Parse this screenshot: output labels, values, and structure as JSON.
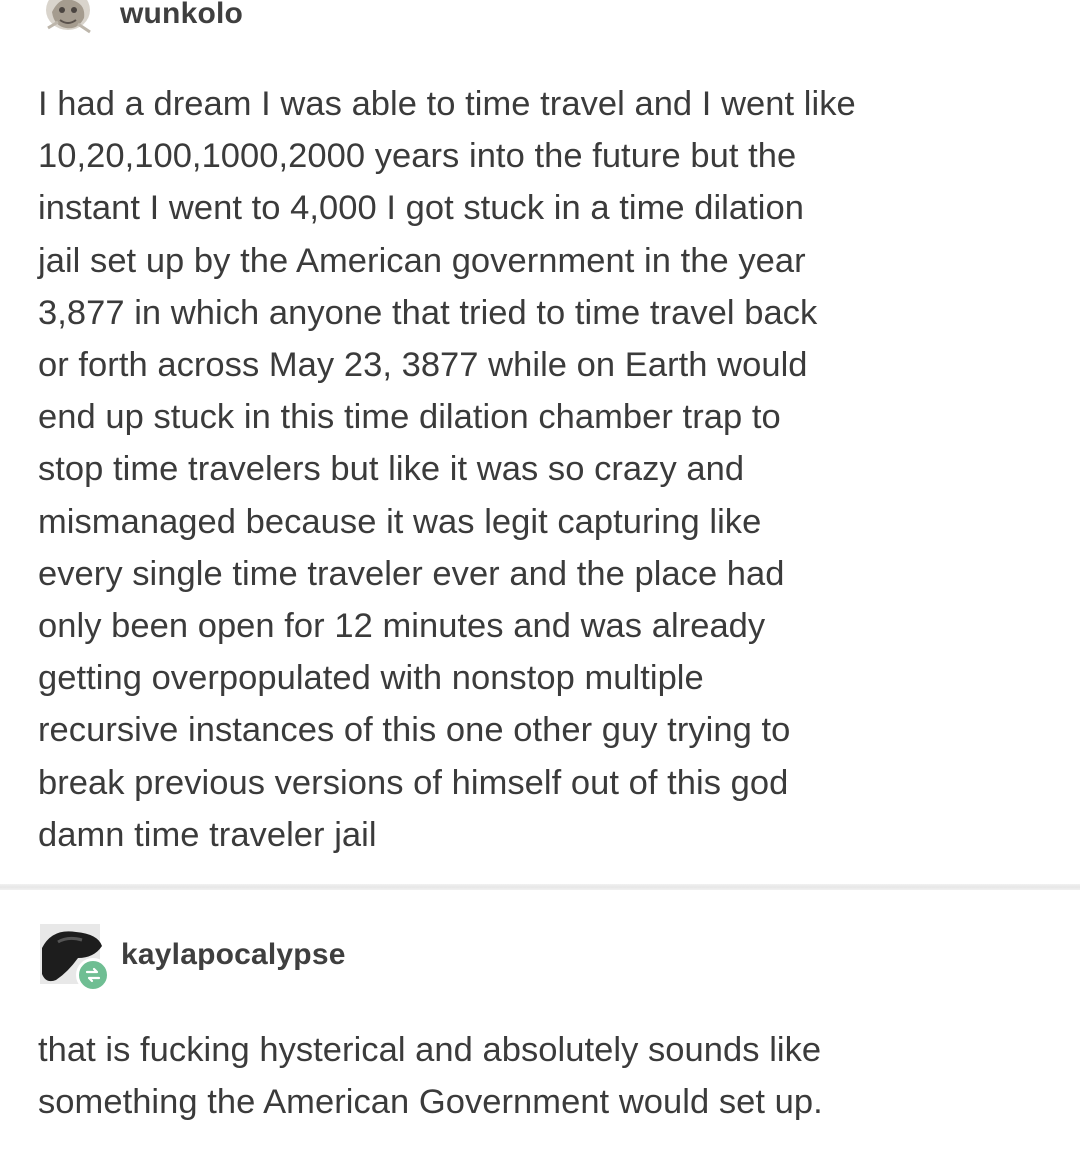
{
  "posts": [
    {
      "username": "wunkolo",
      "avatar": "avatar-icon",
      "text": "I had a dream I was able to time travel and I went like\n10,20,100,1000,2000 years into the future but the\ninstant I went to 4,000 I got stuck in a time dilation\njail set up by the American government in the year\n3,877 in which anyone that tried to time travel back\nor forth across May 23, 3877 while on Earth would\nend up stuck in this time dilation chamber trap to\nstop time travelers but like it was so crazy and\nmismanaged because it was legit capturing like\nevery single time traveler ever and the place had\nonly been open for 12 minutes and was already\ngetting overpopulated with nonstop multiple\nrecursive instances of this one other guy trying to\nbreak previous versions of himself out of this god\ndamn time traveler jail"
    },
    {
      "username": "kaylapocalypse",
      "avatar": "avatar-icon",
      "badge": "reblog-icon",
      "text": "that is fucking hysterical and absolutely sounds like\nsomething the American Government would set up."
    }
  ],
  "colors": {
    "text": "#3b3b3b",
    "username": "#3f3f3f",
    "badge": "#6fbe93",
    "divider": "#e9e9e9",
    "background": "#ffffff"
  }
}
